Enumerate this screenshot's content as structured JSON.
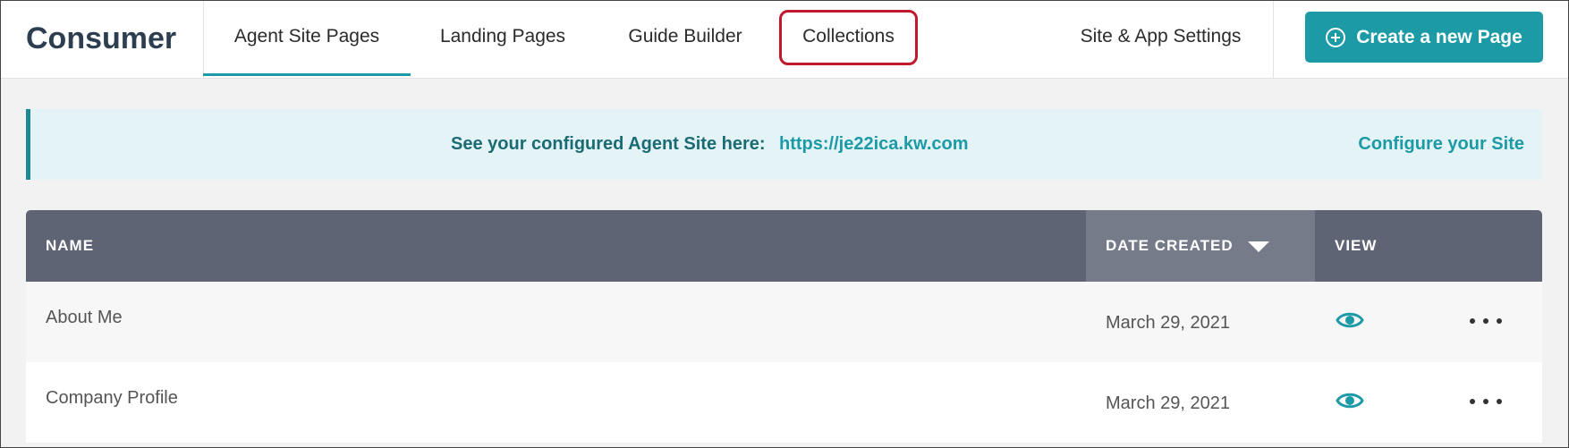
{
  "header": {
    "brand": "Consumer",
    "tabs": [
      {
        "label": "Agent Site Pages",
        "active": true
      },
      {
        "label": "Landing Pages",
        "active": false
      },
      {
        "label": "Guide Builder",
        "active": false
      },
      {
        "label": "Collections",
        "active": false,
        "highlighted": true
      },
      {
        "label": "Site & App Settings",
        "active": false
      }
    ],
    "create_button": {
      "label": "Create a new Page",
      "icon": "plus-circle-icon"
    }
  },
  "banner": {
    "text": "See your configured Agent Site here:",
    "link": "https://je22ica.kw.com",
    "config_link": "Configure your Site"
  },
  "table": {
    "columns": {
      "name": "NAME",
      "date": "DATE CREATED",
      "view": "VIEW"
    },
    "sort": {
      "column": "date",
      "direction": "desc",
      "icon": "sort-down-icon"
    },
    "rows": [
      {
        "name": "About Me",
        "date": "March 29, 2021",
        "view_icon": "eye-icon",
        "menu_icon": "more-horizontal-icon"
      },
      {
        "name": "Company Profile",
        "date": "March 29, 2021",
        "view_icon": "eye-icon",
        "menu_icon": "more-horizontal-icon"
      }
    ]
  },
  "colors": {
    "accent": "#1c9aa6",
    "header_bg": "#5f6474",
    "highlight": "#c0192e",
    "banner_bg": "#e3f3f6"
  }
}
